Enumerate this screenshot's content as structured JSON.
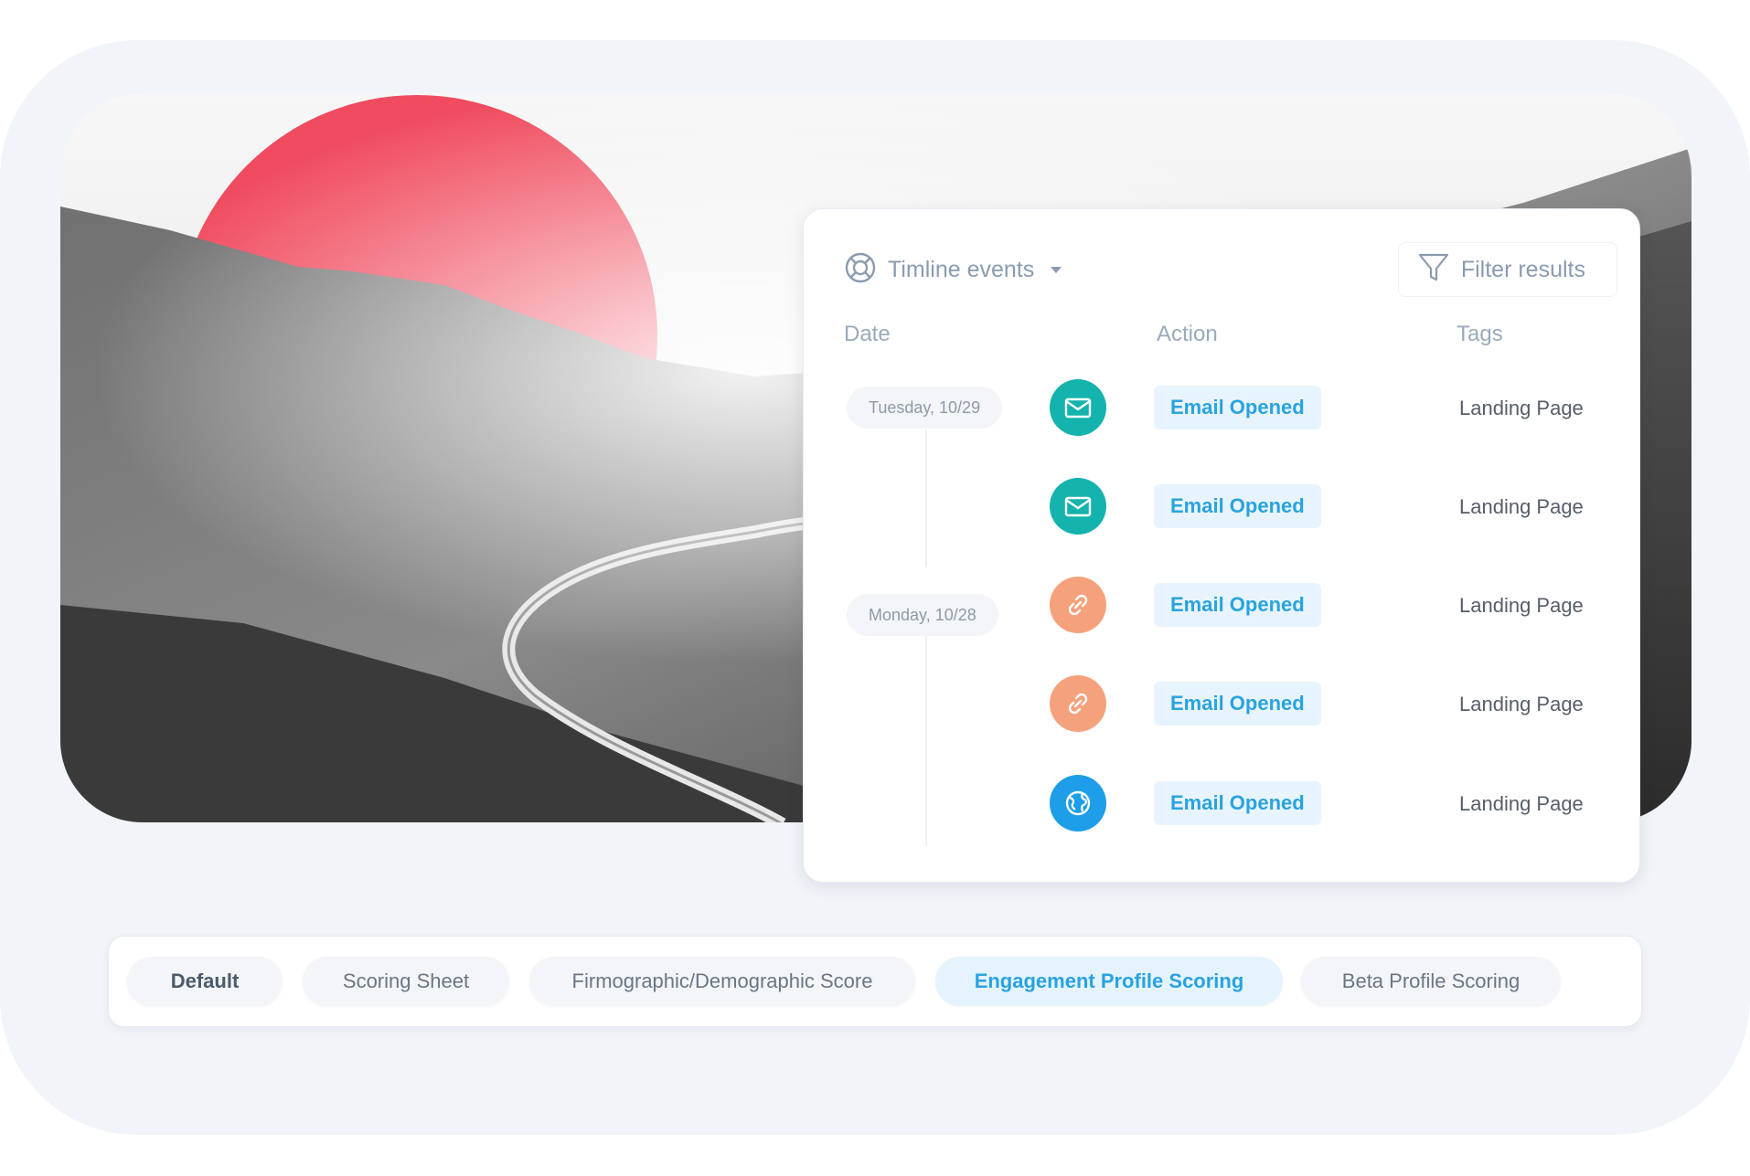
{
  "timeline": {
    "title": "Timline events",
    "filter_label": "Filter results",
    "columns": {
      "date": "Date",
      "action": "Action",
      "tags": "Tags"
    },
    "dates": [
      "Tuesday, 10/29",
      "Monday, 10/28"
    ],
    "events": [
      {
        "icon": "envelope-icon",
        "color": "#14b3ad",
        "action": "Email Opened",
        "tag": "Landing Page"
      },
      {
        "icon": "envelope-icon",
        "color": "#14b3ad",
        "action": "Email Opened",
        "tag": "Landing Page"
      },
      {
        "icon": "link-icon",
        "color": "#f5a27c",
        "action": "Email Opened",
        "tag": "Landing Page"
      },
      {
        "icon": "link-icon",
        "color": "#f5a27c",
        "action": "Email Opened",
        "tag": "Landing Page"
      },
      {
        "icon": "globe-icon",
        "color": "#1e9ee8",
        "action": "Email Opened",
        "tag": "Landing Page"
      }
    ]
  },
  "tabs": [
    {
      "label": "Default",
      "state": "default-bold"
    },
    {
      "label": "Scoring Sheet",
      "state": "normal"
    },
    {
      "label": "Firmographic/Demographic Score",
      "state": "normal"
    },
    {
      "label": "Engagement Profile Scoring",
      "state": "active"
    },
    {
      "label": "Beta Profile Scoring",
      "state": "normal"
    }
  ],
  "colors": {
    "accent": "#29a3df",
    "sun": "#f04b5e",
    "panel_bg": "#ffffff",
    "frame_bg": "#f1f4f8"
  }
}
